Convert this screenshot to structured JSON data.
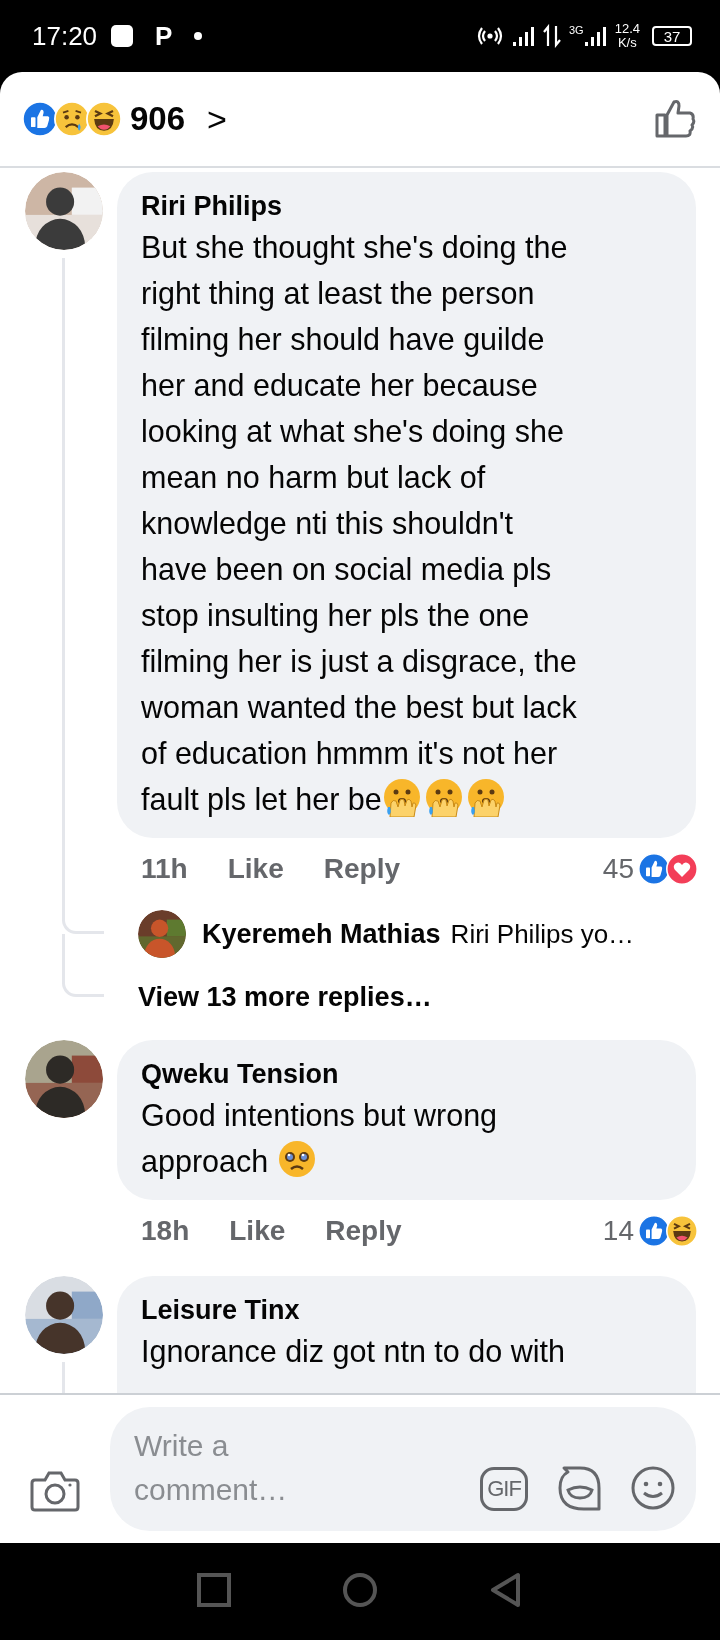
{
  "status_bar": {
    "time": "17:20",
    "notification_letter": "P",
    "network_type": "3G",
    "speed_value": "12.4",
    "speed_unit": "K/s",
    "battery": "37"
  },
  "reactions_header": {
    "reactions": [
      {
        "kind": "like"
      },
      {
        "kind": "sad"
      },
      {
        "kind": "haha"
      }
    ],
    "count": "906",
    "chevron": ">"
  },
  "comments": [
    {
      "author": "Riri Philips",
      "avatar": {
        "kind": "picture"
      },
      "text": "But she thought she's doing the\nright thing at least the person\nfilming her should have guilde\nher and educate her because\nlooking at what she's doing she\nmean no harm but lack of\nknowledge nti this shouldn't\nhave been on social media pls\nstop insulting her pls the one\nfilming her is just a disgrace, the\nwoman wanted the best but lack\nof education hmmm it's not her\nfault pls let her be",
      "emojis": [
        {
          "kind": "hand_over_mouth"
        },
        {
          "kind": "hand_over_mouth"
        },
        {
          "kind": "hand_over_mouth"
        }
      ],
      "time": "11h",
      "like": "Like",
      "reply": "Reply",
      "reaction_count": "45",
      "reactions": [
        {
          "kind": "like"
        },
        {
          "kind": "love"
        }
      ],
      "has_thread": true,
      "replies": [
        {
          "author": "Kyeremeh Mathias",
          "text": "Riri Philips yo…",
          "avatar": {
            "kind": "picture"
          }
        }
      ],
      "view_more": "View 13 more replies…"
    },
    {
      "author": "Qweku Tension",
      "avatar": {
        "kind": "picture"
      },
      "text": "Good intentions but wrong\napproach ",
      "emojis": [
        {
          "kind": "pleading"
        }
      ],
      "time": "18h",
      "like": "Like",
      "reply": "Reply",
      "reaction_count": "14",
      "reactions": [
        {
          "kind": "like"
        },
        {
          "kind": "haha"
        }
      ],
      "has_thread": false
    },
    {
      "author": "Leisure Tinx",
      "avatar": {
        "kind": "picture"
      },
      "text": "Ignorance diz got ntn to do with",
      "cut": true,
      "has_thread": true
    }
  ],
  "composer": {
    "placeholder": "Write a comment…",
    "gif_label": "GIF"
  }
}
